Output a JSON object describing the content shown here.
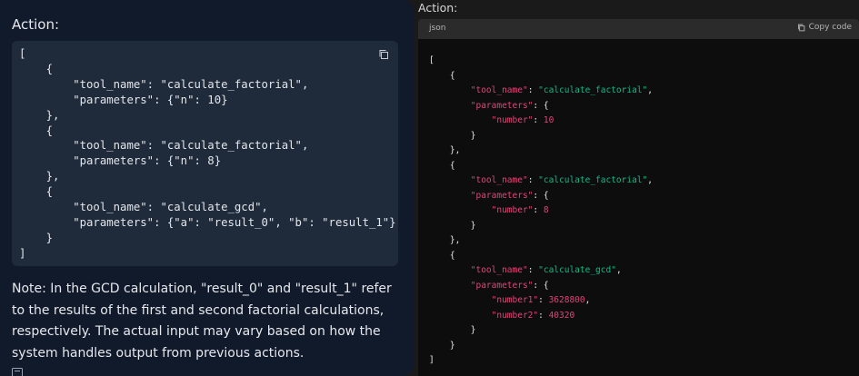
{
  "left": {
    "title": "Action:",
    "code": "[\n    {\n        \"tool_name\": \"calculate_factorial\",\n        \"parameters\": {\"n\": 10}\n    },\n    {\n        \"tool_name\": \"calculate_factorial\",\n        \"parameters\": {\"n\": 8}\n    },\n    {\n        \"tool_name\": \"calculate_gcd\",\n        \"parameters\": {\"a\": \"result_0\", \"b\": \"result_1\"}\n    }\n]",
    "note": "Note: In the GCD calculation, \"result_0\" and \"result_1\" refer to the results of the first and second factorial calculations, respectively. The actual input may vary based on how the system handles output from previous actions.",
    "copy_icon": "copy-icon"
  },
  "right": {
    "title": "Action:",
    "language": "json",
    "copy_label": "Copy code",
    "copy_icon": "copy-icon",
    "tokens": {
      "tool_name_key": "\"tool_name\"",
      "parameters_key": "\"parameters\"",
      "number_key": "\"number\"",
      "number1_key": "\"number1\"",
      "number2_key": "\"number2\"",
      "fact_val": "\"calculate_factorial\"",
      "gcd_val": "\"calculate_gcd\"",
      "v10": "10",
      "v8": "8",
      "v3628800": "3628800",
      "v40320": "40320"
    }
  },
  "colors": {
    "left_bg": "#111a2b",
    "left_code_bg": "#1f2a3b",
    "right_code_bg": "#0d0d0d",
    "key_color": "#e0457b",
    "string_color": "#13b886"
  }
}
